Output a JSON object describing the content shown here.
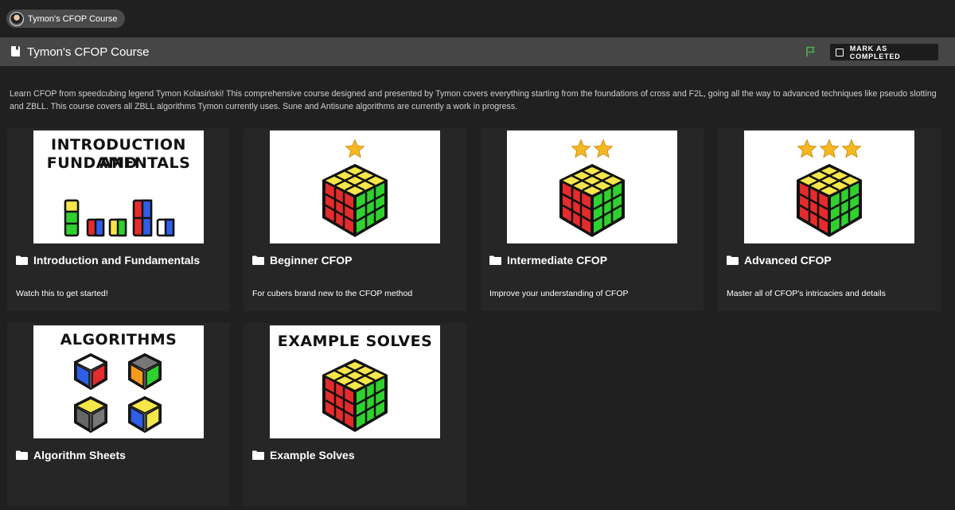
{
  "top_chip": {
    "label": "Tymon's CFOP Course"
  },
  "header": {
    "title": "Tymon's CFOP Course",
    "mark_completed": "MARK AS COMPLETED"
  },
  "description": "Learn CFOP from speedcubing legend Tymon Kolasiński! This comprehensive course designed and presented by Tymon covers everything starting from the foundations of cross and F2L, going all the way to advanced techniques like pseudo slotting and ZBLL. This course covers all ZBLL algorithms Tymon currently uses. Sune and Antisune algorithms are currently a work in progress.",
  "cards": [
    {
      "title": "Introduction and Fundamentals",
      "subtitle": "Watch this to get started!",
      "thumb_line1": "INTRODUCTION AND",
      "thumb_line2": "FUNDAMENTALS"
    },
    {
      "title": "Beginner CFOP",
      "subtitle": "For cubers brand new to the CFOP method",
      "stars": 1
    },
    {
      "title": "Intermediate CFOP",
      "subtitle": "Improve your understanding of CFOP",
      "stars": 2
    },
    {
      "title": "Advanced CFOP",
      "subtitle": "Master all of CFOP's intricacies and details",
      "stars": 3
    },
    {
      "title": "Algorithm Sheets",
      "subtitle": "",
      "thumb_line1": "ALGORITHMS"
    },
    {
      "title": "Example Solves",
      "subtitle": "",
      "thumb_line1": "EXAMPLE SOLVES"
    }
  ],
  "colors": {
    "accent_flag": "#4caf50",
    "cube_top": "#f5e64a",
    "cube_left": "#e52b2b",
    "cube_right": "#2fd12f",
    "star": "#f6b821"
  }
}
